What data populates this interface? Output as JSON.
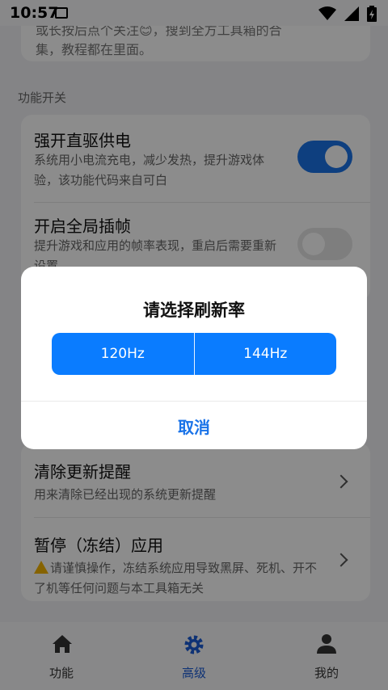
{
  "status": {
    "time": "10:57"
  },
  "top_card": {
    "line1": "或长按后点个关注😊，搜到全方工具箱的合",
    "line2": "集，教程都在里面。"
  },
  "section_title": "功能开关",
  "items": [
    {
      "title": "强开直驱供电",
      "desc": "系统用小电流充电，减少发热，提升游戏体验，该功能代码来自可白",
      "switch_on": true
    },
    {
      "title": "开启全局插帧",
      "desc": "提升游戏和应用的帧率表现，重启后需要重新设置",
      "switch_on": false
    }
  ],
  "bottom_items": [
    {
      "title": "清除更新提醒",
      "desc": "用来清除已经出现的系统更新提醒"
    },
    {
      "title": "暂停（冻结）应用",
      "desc": "请谨慎操作，冻结系统应用导致黑屏、死机、开不了机等任何问题与本工具箱无关"
    }
  ],
  "dialog": {
    "title": "请选择刷新率",
    "options": [
      "120Hz",
      "144Hz"
    ],
    "cancel": "取消"
  },
  "nav": [
    {
      "label": "功能",
      "icon": "home-icon"
    },
    {
      "label": "高级",
      "icon": "gear-icon",
      "active": true
    },
    {
      "label": "我的",
      "icon": "user-icon"
    }
  ],
  "colors": {
    "accent": "#1a73e8",
    "dialog_button": "#0a7cff"
  }
}
